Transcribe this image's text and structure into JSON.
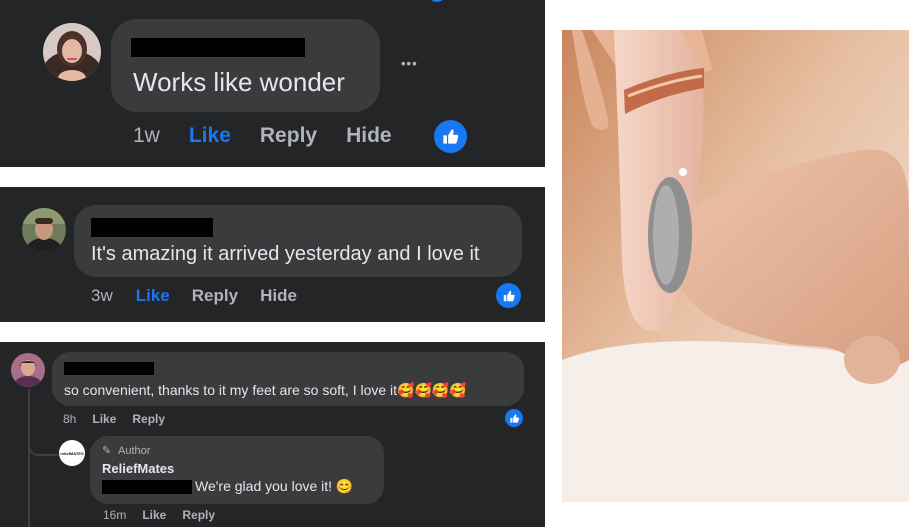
{
  "comment1": {
    "text": "Works like wonder",
    "time": "1w",
    "like": "Like",
    "reply": "Reply",
    "hide": "Hide",
    "more": "•••"
  },
  "comment2": {
    "text": "It's amazing it arrived yesterday and I love it",
    "time": "3w",
    "like": "Like",
    "reply": "Reply",
    "hide": "Hide"
  },
  "comment3": {
    "text": "so convenient, thanks to it my feet are so soft, I love it🥰🥰🥰🥰",
    "time": "8h",
    "like": "Like",
    "reply": "Reply"
  },
  "reply": {
    "badge": "Author",
    "name": "ReliefMates",
    "text": "We're glad you love it! 😊",
    "time": "16m",
    "like": "Like",
    "reply": "Reply",
    "logo_text": "reliefMATES"
  },
  "colors": {
    "panel_bg": "#242526",
    "bubble_bg": "#3a3b3c",
    "text": "#e4e6eb",
    "muted": "#b0b3b8",
    "accent": "#1877f2"
  }
}
